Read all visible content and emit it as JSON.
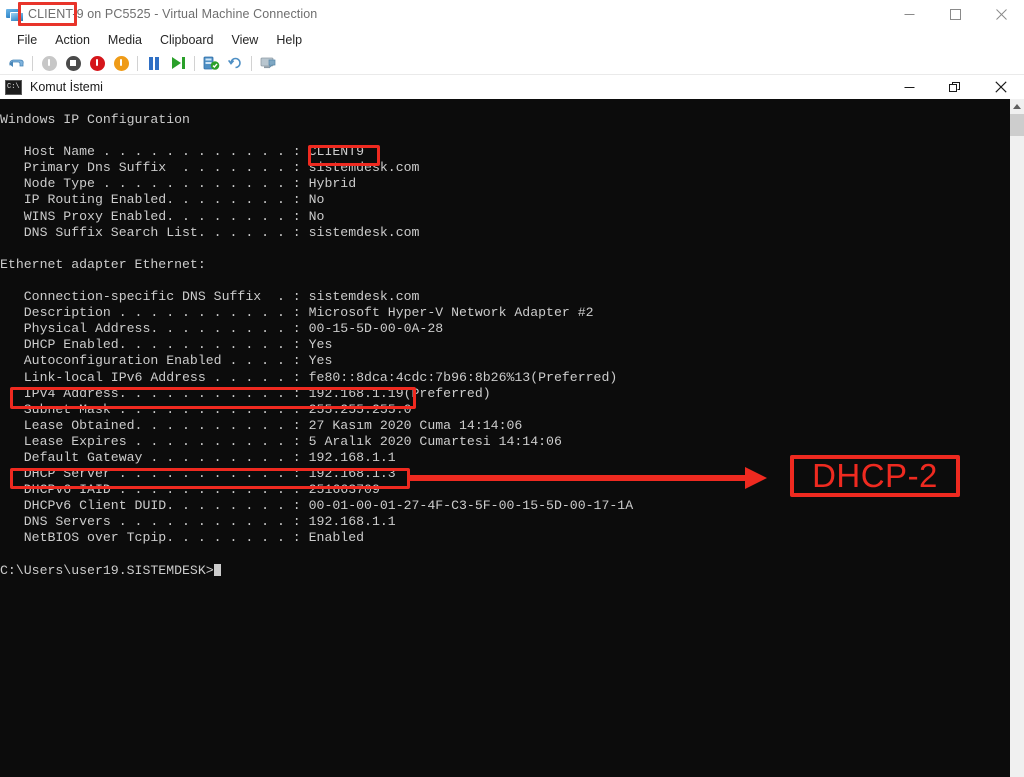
{
  "vm_window": {
    "title_highlighted": "CLIENT-9",
    "title_rest": " on PC5525 - Virtual Machine Connection",
    "app_icon": "virtual-machine-icon",
    "menus": [
      "File",
      "Action",
      "Media",
      "Clipboard",
      "View",
      "Help"
    ],
    "toolbar_icons": [
      "ctrl-alt-delete-icon",
      "shutdown-icon",
      "turn-off-icon",
      "power-off-icon",
      "start-icon",
      "pause-icon",
      "resume-icon",
      "checkpoint-icon",
      "revert-icon",
      "enhanced-session-icon"
    ],
    "window_buttons": [
      "minimize",
      "maximize",
      "close"
    ]
  },
  "cmd_window": {
    "title": "Komut İstemi",
    "icon": "command-prompt-icon",
    "window_buttons": [
      "minimize",
      "restore",
      "close"
    ]
  },
  "console": {
    "lines": [
      "Windows IP Configuration",
      "",
      "   Host Name . . . . . . . . . . . . : CLIENT9",
      "   Primary Dns Suffix  . . . . . . . : sistemdesk.com",
      "   Node Type . . . . . . . . . . . . : Hybrid",
      "   IP Routing Enabled. . . . . . . . : No",
      "   WINS Proxy Enabled. . . . . . . . : No",
      "   DNS Suffix Search List. . . . . . : sistemdesk.com",
      "",
      "Ethernet adapter Ethernet:",
      "",
      "   Connection-specific DNS Suffix  . : sistemdesk.com",
      "   Description . . . . . . . . . . . : Microsoft Hyper-V Network Adapter #2",
      "   Physical Address. . . . . . . . . : 00-15-5D-00-0A-28",
      "   DHCP Enabled. . . . . . . . . . . : Yes",
      "   Autoconfiguration Enabled . . . . : Yes",
      "   Link-local IPv6 Address . . . . . : fe80::8dca:4cdc:7b96:8b26%13(Preferred)",
      "   IPv4 Address. . . . . . . . . . . : 192.168.1.19(Preferred)",
      "   Subnet Mask . . . . . . . . . . . : 255.255.255.0",
      "   Lease Obtained. . . . . . . . . . : 27 Kasım 2020 Cuma 14:14:06",
      "   Lease Expires . . . . . . . . . . : 5 Aralık 2020 Cumartesi 14:14:06",
      "   Default Gateway . . . . . . . . . : 192.168.1.1",
      "   DHCP Server . . . . . . . . . . . : 192.168.1.3",
      "   DHCPv6 IAID . . . . . . . . . . . : 251663709",
      "   DHCPv6 Client DUID. . . . . . . . : 00-01-00-01-27-4F-C3-5F-00-15-5D-00-17-1A",
      "   DNS Servers . . . . . . . . . . . : 192.168.1.1",
      "   NetBIOS over Tcpip. . . . . . . . : Enabled",
      "",
      "C:\\Users\\user19.SISTEMDESK>"
    ],
    "prompt_path": "C:\\Users\\user19.SISTEMDESK>",
    "values": {
      "host_name": "CLIENT9",
      "primary_dns_suffix": "sistemdesk.com",
      "node_type": "Hybrid",
      "ip_routing_enabled": "No",
      "wins_proxy_enabled": "No",
      "dns_suffix_search_list": "sistemdesk.com",
      "adapter": "Ethernet adapter Ethernet:",
      "connection_specific_dns_suffix": "sistemdesk.com",
      "description": "Microsoft Hyper-V Network Adapter #2",
      "physical_address": "00-15-5D-00-0A-28",
      "dhcp_enabled": "Yes",
      "autoconfiguration_enabled": "Yes",
      "link_local_ipv6": "fe80::8dca:4cdc:7b96:8b26%13(Preferred)",
      "ipv4_address": "192.168.1.19(Preferred)",
      "subnet_mask": "255.255.255.0",
      "lease_obtained": "27 Kasım 2020 Cuma 14:14:06",
      "lease_expires": "5 Aralık 2020 Cumartesi 14:14:06",
      "default_gateway": "192.168.1.1",
      "dhcp_server": "192.168.1.3",
      "dhcpv6_iaid": "251663709",
      "dhcpv6_client_duid": "00-01-00-01-27-4F-C3-5F-00-15-5D-00-17-1A",
      "dns_servers": "192.168.1.1",
      "netbios_over_tcpip": "Enabled"
    }
  },
  "annotations": {
    "accent_color": "#ef2a20",
    "callout_label": "DHCP-2",
    "highlight_title": "CLIENT-9",
    "highlight_host_name": "CLIENT9",
    "highlight_ipv4_line": "IPv4 Address. . . . . . . . . . . : 192.168.1.19",
    "highlight_dhcp_line": "DHCP Server . . . . . . . . . . . : 192.168.1.3"
  },
  "scrollbar": {
    "up_arrow": "scroll-up-arrow-icon"
  }
}
